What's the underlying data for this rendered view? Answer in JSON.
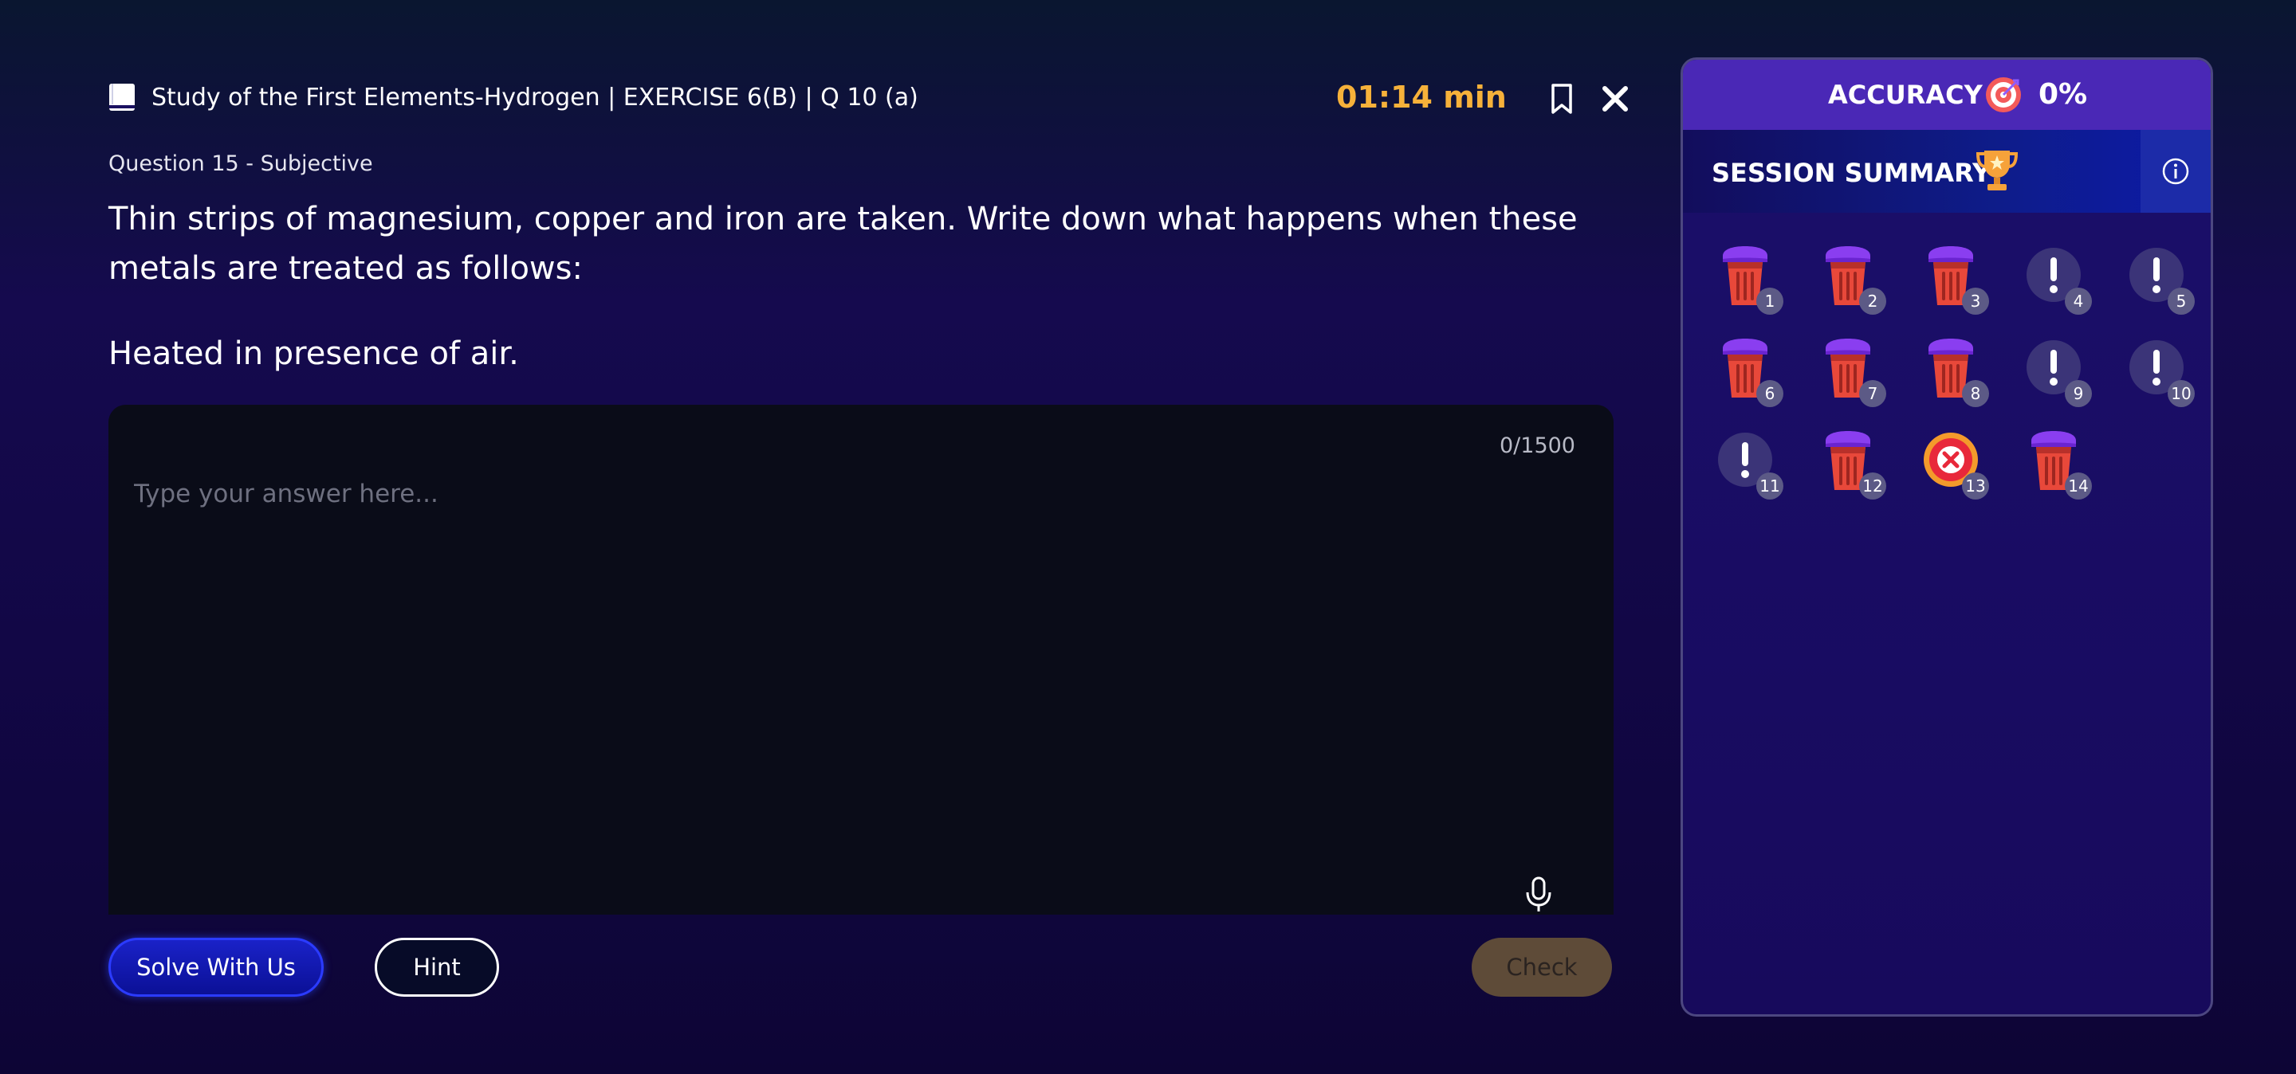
{
  "header": {
    "chapter_title": "Study of the First Elements-Hydrogen | EXERCISE 6(B) | Q 10 (a)",
    "timer": "01:14 min",
    "icons": [
      "book-icon",
      "bookmark-icon",
      "close-icon"
    ]
  },
  "question": {
    "meta": "Question 15 - Subjective",
    "text": "Thin strips of magnesium, copper and iron are taken. Write down what happens when these metals are treated as follows:",
    "sub_text": "Heated in presence of air."
  },
  "answer": {
    "char_count": "0/1500",
    "placeholder": "Type your answer here...",
    "value": "",
    "mic_icon": "microphone-icon"
  },
  "buttons": {
    "solve": "Solve With Us",
    "hint": "Hint",
    "check": "Check"
  },
  "panel": {
    "accuracy_label": "ACCURACY",
    "accuracy_value": "0%",
    "summary_label": "SESSION SUMMARY",
    "icons": [
      "target-icon",
      "trophy-icon",
      "info-icon"
    ],
    "items": [
      {
        "number": "1",
        "status": "skipped"
      },
      {
        "number": "2",
        "status": "skipped"
      },
      {
        "number": "3",
        "status": "skipped"
      },
      {
        "number": "4",
        "status": "attempted"
      },
      {
        "number": "5",
        "status": "attempted"
      },
      {
        "number": "6",
        "status": "skipped"
      },
      {
        "number": "7",
        "status": "skipped"
      },
      {
        "number": "8",
        "status": "skipped"
      },
      {
        "number": "9",
        "status": "attempted"
      },
      {
        "number": "10",
        "status": "attempted"
      },
      {
        "number": "11",
        "status": "attempted"
      },
      {
        "number": "12",
        "status": "skipped"
      },
      {
        "number": "13",
        "status": "incorrect"
      },
      {
        "number": "14",
        "status": "skipped"
      }
    ]
  },
  "colors": {
    "timer": "#f6b13a",
    "accuracy_bar": "#4a28b6",
    "check_button": "#5e4b38",
    "solve_button": "#1a22c8",
    "bin_body": "#e8483a",
    "bin_lid": "#8a3ef0",
    "incorrect_ring": "#f39a2b"
  }
}
